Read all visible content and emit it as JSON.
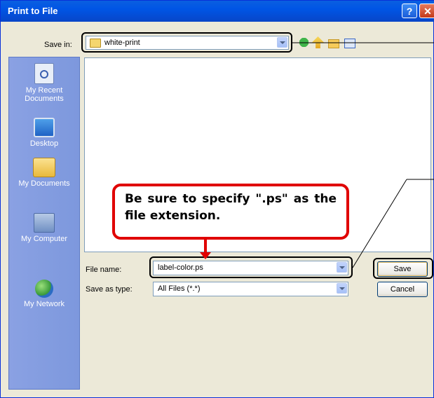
{
  "window": {
    "title": "Print to File"
  },
  "title_buttons": {
    "help": "?",
    "close": "✕"
  },
  "toolbar": {
    "save_in_label": "Save in:",
    "save_in_value": "white-print",
    "icons": [
      "back-icon",
      "up-folder-icon",
      "new-folder-icon",
      "views-icon"
    ]
  },
  "places": [
    {
      "label": "My Recent\nDocuments",
      "icon": "recent-documents-icon"
    },
    {
      "label": "Desktop",
      "icon": "desktop-icon"
    },
    {
      "label": "My Documents",
      "icon": "my-documents-icon"
    },
    {
      "label": "My Computer",
      "icon": "my-computer-icon"
    },
    {
      "label": "My Network",
      "icon": "my-network-icon"
    }
  ],
  "form": {
    "file_name_label": "File name:",
    "file_name_value": "label-color.ps",
    "save_as_type_label": "Save as type:",
    "save_as_type_value": "All Files (*.*)"
  },
  "buttons": {
    "save": "Save",
    "cancel": "Cancel"
  },
  "annotation": {
    "note": "Be sure to specify \".ps\" as the file extension."
  },
  "colors": {
    "titlebar": "#0055E5",
    "dialog_bg": "#ECE9D8",
    "places_bar": "#7E97DE",
    "note_border": "#E00000"
  }
}
